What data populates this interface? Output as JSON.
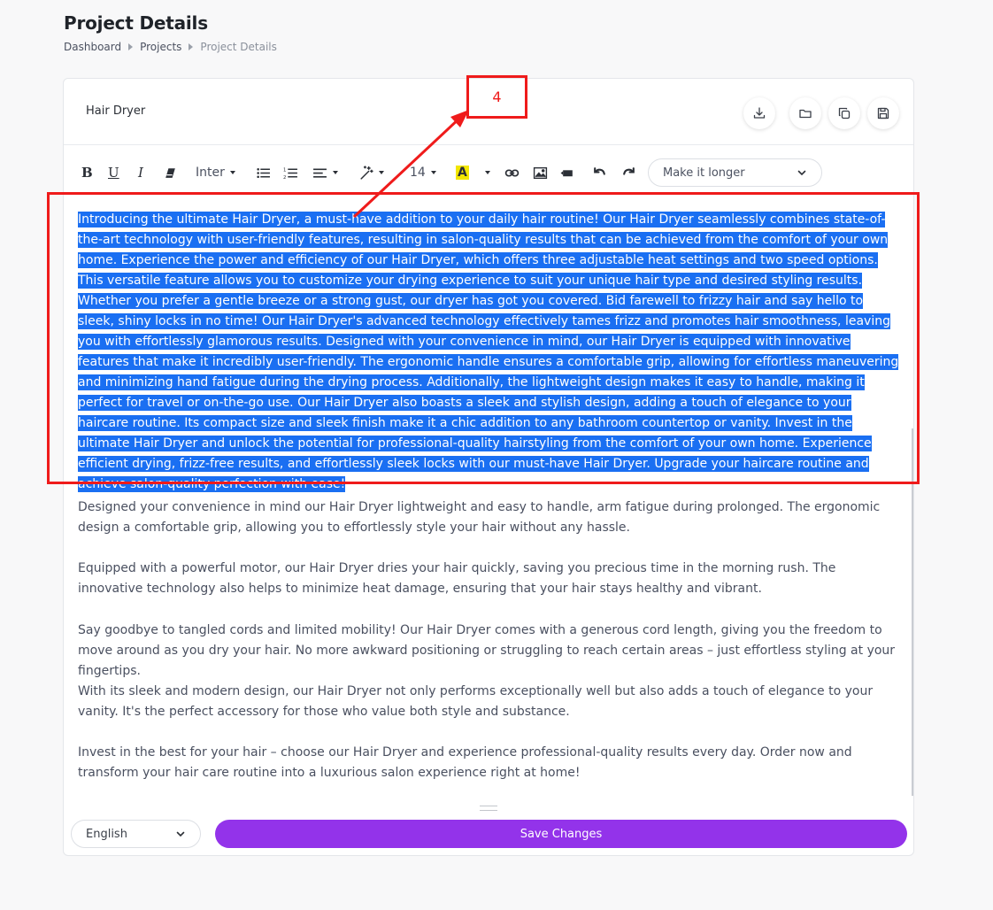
{
  "page": {
    "title": "Project Details",
    "breadcrumb": [
      "Dashboard",
      "Projects",
      "Project Details"
    ]
  },
  "card": {
    "title": "Hair Dryer",
    "header_icons": [
      "download-icon",
      "folder-icon",
      "copy-icon",
      "save-icon"
    ]
  },
  "toolbar": {
    "font_family": "Inter",
    "font_size": "14",
    "ai_option": "Make it longer",
    "icons": [
      "bold-icon",
      "underline-icon",
      "italic-icon",
      "eraser-icon",
      "bullet-list-icon",
      "numbered-list-icon",
      "align-icon",
      "magic-wand-icon",
      "text-color-icon",
      "link-icon",
      "image-icon",
      "video-icon",
      "undo-icon",
      "redo-icon"
    ]
  },
  "editor": {
    "selected_paragraph": "Introducing the ultimate Hair Dryer, a must-have addition to your daily hair routine! Our Hair Dryer seamlessly combines state-of-the-art technology with user-friendly features, resulting in salon-quality results that can be achieved from the comfort of your own home. Experience the power and efficiency of our Hair Dryer, which offers three adjustable heat settings and two speed options. This versatile feature allows you to customize your drying experience to suit your unique hair type and desired styling results. Whether you prefer a gentle breeze or a strong gust, our dryer has got you covered. Bid farewell to frizzy hair and say hello to sleek, shiny locks in no time! Our Hair Dryer's advanced technology effectively tames frizz and promotes hair smoothness, leaving you with effortlessly glamorous results. Designed with your convenience in mind, our Hair Dryer is equipped with innovative features that make it incredibly user-friendly. The ergonomic handle ensures a comfortable grip, allowing for effortless maneuvering and minimizing hand fatigue during the drying process. Additionally, the lightweight design makes it easy to handle, making it perfect for travel or on-the-go use. Our Hair Dryer also boasts a sleek and stylish design, adding a touch of elegance to your haircare routine. Its compact size and sleek finish make it a chic addition to any bathroom countertop or vanity. Invest in the ultimate Hair Dryer and unlock the potential for professional-quality hairstyling from the comfort of your own home. Experience efficient drying, frizz-free results, and effortlessly sleek locks with our must-have Hair Dryer. Upgrade your haircare routine and achieve salon-quality perfection with ease!",
    "paragraphs": [
      "Designed your convenience in mind our Hair Dryer lightweight and easy to handle, arm fatigue during prolonged. The ergonomic design a comfortable grip, allowing you to effortlessly style your hair without any hassle.",
      "Equipped with a powerful motor, our Hair Dryer dries your hair quickly, saving you precious time in the morning rush. The innovative technology also helps to minimize heat damage, ensuring that your hair stays healthy and vibrant.",
      "Say goodbye to tangled cords and limited mobility! Our Hair Dryer comes with a generous cord length, giving you the freedom to move around as you dry your hair. No more awkward positioning or struggling to reach certain areas – just effortless styling at your fingertips.",
      "With its sleek and modern design, our Hair Dryer not only performs exceptionally well but also adds a touch of elegance to your vanity. It's the perfect accessory for those who value both style and substance.",
      "Invest in the best for your hair – choose our Hair Dryer and experience professional-quality results every day. Order now and transform your hair care routine into a luxurious salon experience right at home!"
    ]
  },
  "footer": {
    "language": "English",
    "save_label": "Save Changes"
  },
  "annotation": {
    "label": "4",
    "color": "#ef1b1b"
  },
  "colors": {
    "accent": "#9333ea",
    "selection": "#1a6ff2"
  }
}
